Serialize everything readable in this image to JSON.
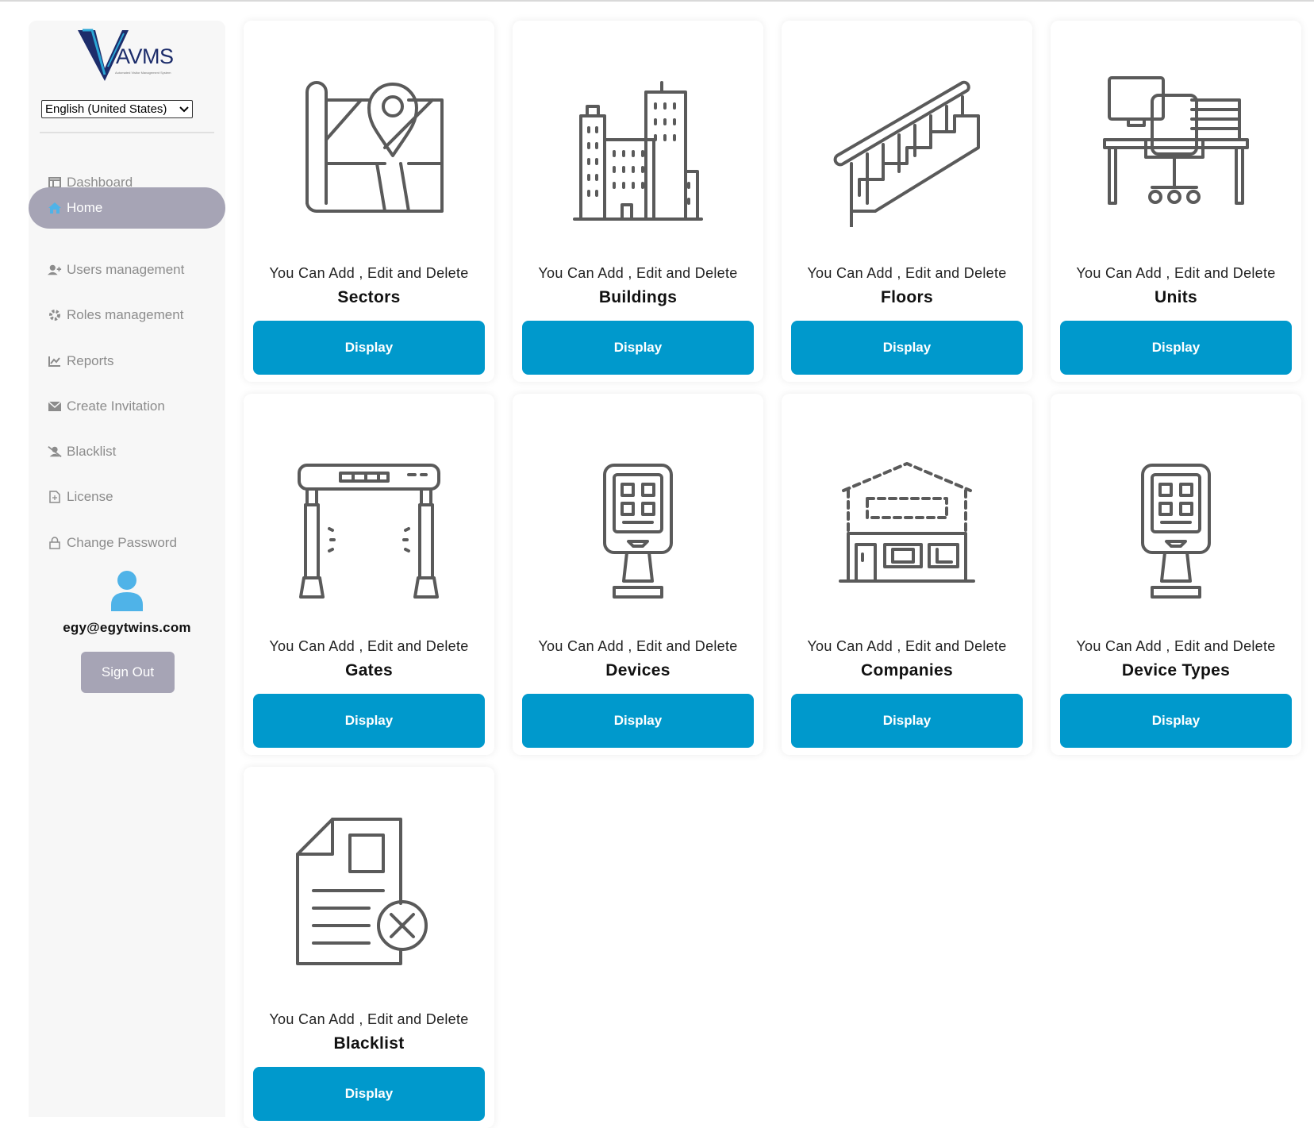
{
  "app": {
    "logo_text": "AVMS",
    "logo_subtitle": "Automated Visitor Management System",
    "language": "English (United States)",
    "user_email": "egy@egytwins.com",
    "sign_out_label": "Sign Out",
    "colors": {
      "accent": "#0099cc",
      "sidebar_active": "#a6a4b5",
      "avatar": "#4fb3e8"
    }
  },
  "sidebar": {
    "items": [
      {
        "label": "Dashboard",
        "icon": "dashboard-icon",
        "active": false
      },
      {
        "label": "Home",
        "icon": "home-icon",
        "active": true
      },
      {
        "label": "Users management",
        "icon": "add-user-icon",
        "active": false
      },
      {
        "label": "Roles management",
        "icon": "gear-icon",
        "active": false
      },
      {
        "label": "Reports",
        "icon": "chart-line-icon",
        "active": false
      },
      {
        "label": "Create Invitation",
        "icon": "envelope-icon",
        "active": false
      },
      {
        "label": "Blacklist",
        "icon": "user-slash-icon",
        "active": false
      },
      {
        "label": "License",
        "icon": "file-icon",
        "active": false
      },
      {
        "label": "Change Password",
        "icon": "lock-icon",
        "active": false
      }
    ]
  },
  "cards": [
    {
      "line1": "You Can Add , Edit and Delete",
      "title": "Sectors",
      "button": "Display",
      "icon": "map-pin-icon"
    },
    {
      "line1": "You Can Add , Edit and Delete",
      "title": "Buildings",
      "button": "Display",
      "icon": "buildings-icon"
    },
    {
      "line1": "You Can Add , Edit and Delete",
      "title": "Floors",
      "button": "Display",
      "icon": "stairs-icon"
    },
    {
      "line1": "You Can Add , Edit and Delete",
      "title": "Units",
      "button": "Display",
      "icon": "office-desk-icon"
    },
    {
      "line1": "You Can Add , Edit and Delete",
      "title": "Gates",
      "button": "Display",
      "icon": "security-gate-icon"
    },
    {
      "line1": "You Can Add , Edit and Delete",
      "title": "Devices",
      "button": "Display",
      "icon": "kiosk-icon"
    },
    {
      "line1": "You Can Add , Edit and Delete",
      "title": "Companies",
      "button": "Display",
      "icon": "company-building-icon"
    },
    {
      "line1": "You Can Add , Edit and Delete",
      "title": "Device Types",
      "button": "Display",
      "icon": "kiosk-icon"
    },
    {
      "line1": "You Can Add , Edit and Delete",
      "title": "Blacklist",
      "button": "Display",
      "icon": "document-x-icon"
    }
  ]
}
